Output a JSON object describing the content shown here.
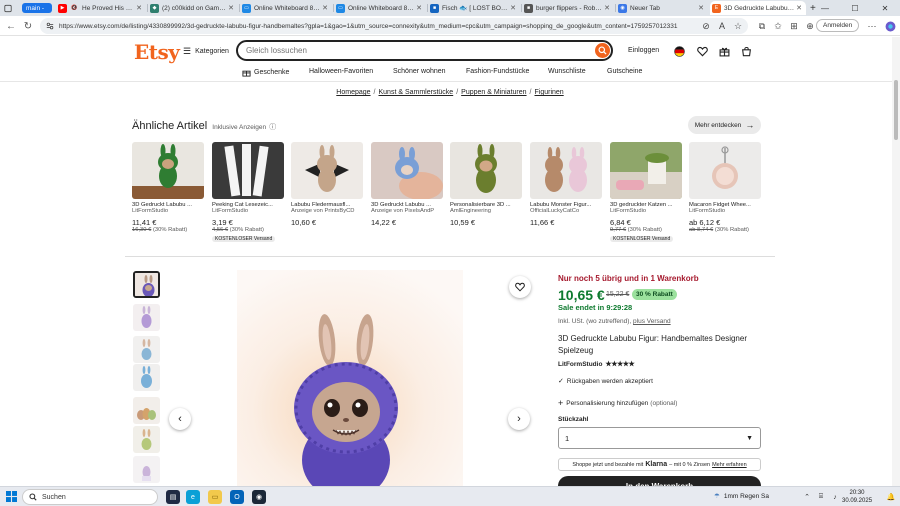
{
  "browser": {
    "tabs": [
      {
        "title": "main -",
        "icon_color": "#1a73e8"
      },
      {
        "title": "He Proved His Mom W",
        "icon_color": "#ff0000"
      },
      {
        "title": "(2) c00kidd on Game Jolt",
        "icon_color": "#2f7f6f"
      },
      {
        "title": "Online Whiteboard 864711",
        "icon_color": "#1e88e5"
      },
      {
        "title": "Online Whiteboard 864511",
        "icon_color": "#1e88e5"
      },
      {
        "title": "Fisch 🐟 [ LOST BONES",
        "icon_color": "#1565c0"
      },
      {
        "title": "burger flippers - Roblox",
        "icon_color": "#555555"
      },
      {
        "title": "Neuer Tab",
        "icon_color": "#3b78e7"
      },
      {
        "title": "3D Gedruckte Labubu Figur",
        "icon_color": "#f1641e"
      }
    ],
    "url": "https://www.etsy.com/de/listing/4330899992/3d-gedruckte-labubu-figur-handbemaltes?gpla=1&gao=1&utm_source=connexity&utm_medium=cpc&utm_campaign=shopping_de_google&utm_content=1759257012331",
    "signin_label": "Anmelden"
  },
  "header": {
    "logo": "Etsy",
    "categories_label": "Kategorien",
    "search_placeholder": "Gleich lossuchen",
    "login_label": "Einloggen"
  },
  "catnav": [
    "Geschenke",
    "Halloween-Favoriten",
    "Schöner wohnen",
    "Fashion-Fundstücke",
    "Wunschliste",
    "Gutscheine"
  ],
  "breadcrumb": [
    "Homepage",
    "Kunst & Sammlerstücke",
    "Puppen & Miniaturen",
    "Figurinen"
  ],
  "similar": {
    "title": "Ähnliche Artikel",
    "subtitle": "Inklusive Anzeigen",
    "more_label": "Mehr entdecken",
    "items": [
      {
        "title": "3D Gedruckt Labubu ...",
        "seller": "LitFormStudio",
        "price": "11,41 €",
        "old": "16,30 €",
        "pct": "(30% Rabatt)",
        "badge": ""
      },
      {
        "title": "Peeking Cat Lesezeic...",
        "seller": "LitFormStudio",
        "price": "3,19 €",
        "old": "4,56 €",
        "pct": "(30% Rabatt)",
        "badge": "KOSTENLOSER Versand"
      },
      {
        "title": "Labubu Fledermausfl...",
        "seller": "Anzeige von PrintsByCD",
        "price": "10,60 €",
        "old": "",
        "pct": "",
        "badge": ""
      },
      {
        "title": "3D Gedruckt Labubu ...",
        "seller": "Anzeige von PixelsAndP",
        "price": "14,22 €",
        "old": "",
        "pct": "",
        "badge": ""
      },
      {
        "title": "Personalisierbare 3D ...",
        "seller": "AmlEngineering",
        "price": "10,59 €",
        "old": "",
        "pct": "",
        "badge": ""
      },
      {
        "title": "Labubu Monster Figur...",
        "seller": "OfficialLuckyCatCo",
        "price": "11,66 €",
        "old": "",
        "pct": "",
        "badge": ""
      },
      {
        "title": "3D gedruckter Katzen ...",
        "seller": "LitFormStudio",
        "price": "6,84 €",
        "old": "9,77 €",
        "pct": "(30% Rabatt)",
        "badge": "KOSTENLOSER Versand"
      },
      {
        "title": "Macaron Fidget Whee...",
        "seller": "LitFormStudio",
        "price": "ab 6,12 €",
        "old": "ab 8,74 €",
        "pct": "(30% Rabatt)",
        "badge": ""
      }
    ]
  },
  "product": {
    "stock": "Nur noch 5 übrig und in 1 Warenkorb",
    "price": "10,65 €",
    "old_price": "15,22 €",
    "discount": "30 % Rabatt",
    "sale_end": "Sale endet in 9:29:28",
    "tax": "Inkl. USt. (wo zutreffend),",
    "shipping_link": "plus Versand",
    "title": "3D Gedruckte Labubu Figur: Handbemaltes Designer Spielzeug",
    "shop": "LitFormStudio",
    "stars": "★★★★★",
    "returns": "Rückgaben werden akzeptiert",
    "personalize": "Personalisierung hinzufügen",
    "personalize_opt": "(optional)",
    "qty_label": "Stückzahl",
    "qty_value": "1",
    "klarna_pre": "Shoppe jetzt und bezahle mit",
    "klarna_brand": "Klarna",
    "klarna_post": "– mit 0 % Zinsen",
    "klarna_link": "Mehr erfahren",
    "cart_label": "In den Warenkorb"
  },
  "taskbar": {
    "search_label": "Suchen",
    "weather": "1mm Regen Sa",
    "time": "20:30",
    "date": "30.09.2025"
  }
}
